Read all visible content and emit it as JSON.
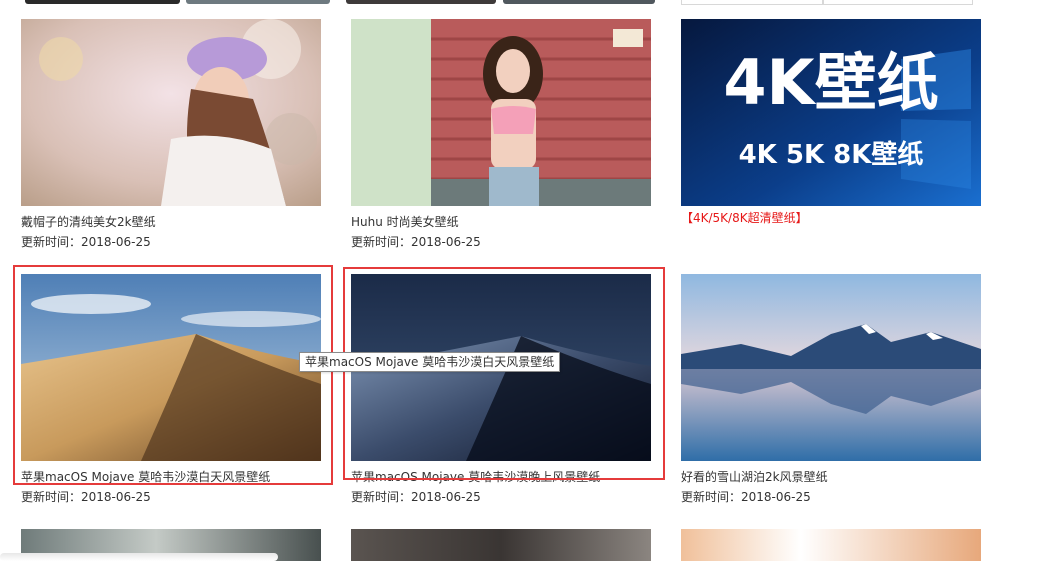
{
  "cards": [
    {
      "title": "戴帽子的清纯美女2k壁纸",
      "date": "更新时间：2018-06-25",
      "image_alt": "girl-beret-photo"
    },
    {
      "title": "Huhu 时尚美女壁纸",
      "date": "更新时间：2018-06-25",
      "image_alt": "girl-shutters-photo"
    },
    {
      "title": "【4K/5K/8K超清壁纸】",
      "date": "",
      "image_alt": "4k-wallpaper-banner",
      "banner_big": "4K壁纸",
      "banner_small": "4K 5K 8K壁纸",
      "title_color": "#e61717"
    },
    {
      "title": "苹果macOS Mojave 莫哈韦沙漠白天风景壁纸",
      "date": "更新时间：2018-06-25",
      "image_alt": "mojave-day"
    },
    {
      "title": "苹果macOS Mojave 莫哈韦沙漠晚上风景壁纸",
      "date": "更新时间：2018-06-25",
      "image_alt": "mojave-night"
    },
    {
      "title": "好看的雪山湖泊2k风景壁纸",
      "date": "更新时间：2018-06-25",
      "image_alt": "snow-mountain-lake"
    }
  ],
  "tooltip": {
    "text": "苹果macOS Mojave 莫哈韦沙漠白天风景壁纸"
  },
  "colors": {
    "highlight": "#e53b3b",
    "promo_title": "#e61717"
  }
}
